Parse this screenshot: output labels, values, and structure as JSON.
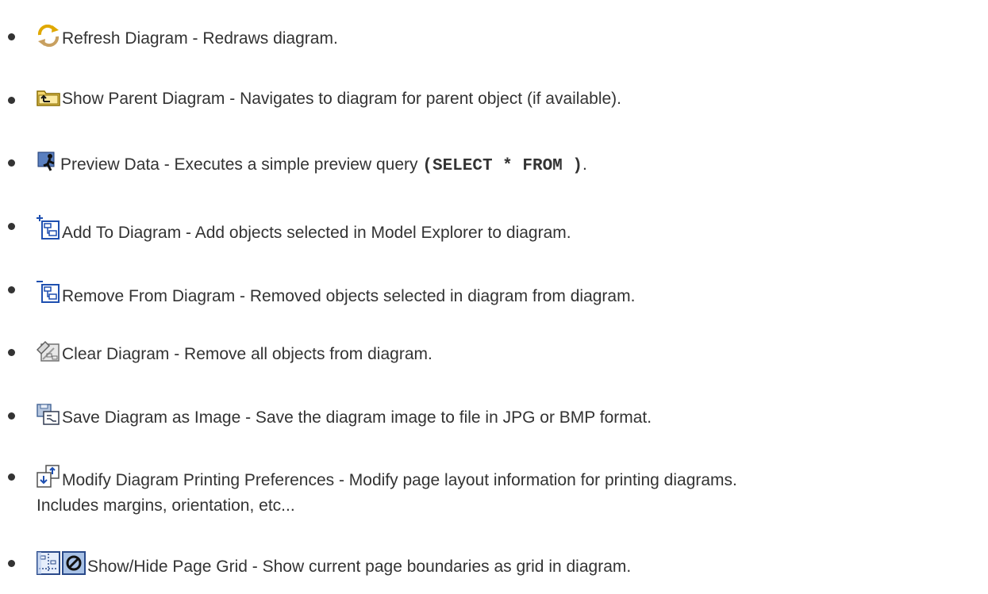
{
  "items": [
    {
      "icon": "refresh-icon",
      "text": "Refresh Diagram - Redraws diagram."
    },
    {
      "icon": "show-parent-icon",
      "text": "Show Parent Diagram - Navigates to diagram for parent object (if available)."
    },
    {
      "icon": "preview-data-icon",
      "text": "Preview Data - Executes a simple preview query ",
      "code": "(SELECT * FROM )",
      "suffix": "."
    },
    {
      "icon": "add-to-diagram-icon",
      "text": "Add To Diagram - Add objects selected in Model Explorer to diagram."
    },
    {
      "icon": "remove-from-diagram-icon",
      "text": "Remove From Diagram - Removed objects selected in diagram from diagram."
    },
    {
      "icon": "clear-diagram-icon",
      "text": "Clear Diagram - Remove all objects from diagram."
    },
    {
      "icon": "save-image-icon",
      "text": "Save Diagram as Image - Save the diagram image to file in JPG or BMP format."
    },
    {
      "icon": "printing-preferences-icon",
      "text": "Modify Diagram Printing Preferences - Modify page layout information for printing diagrams.",
      "text2": "Includes margins, orientation, etc..."
    },
    {
      "icon": "page-grid-icon",
      "icon2": "hide-grid-icon",
      "text": "Show/Hide Page Grid - Show current page boundaries as grid in diagram."
    }
  ]
}
